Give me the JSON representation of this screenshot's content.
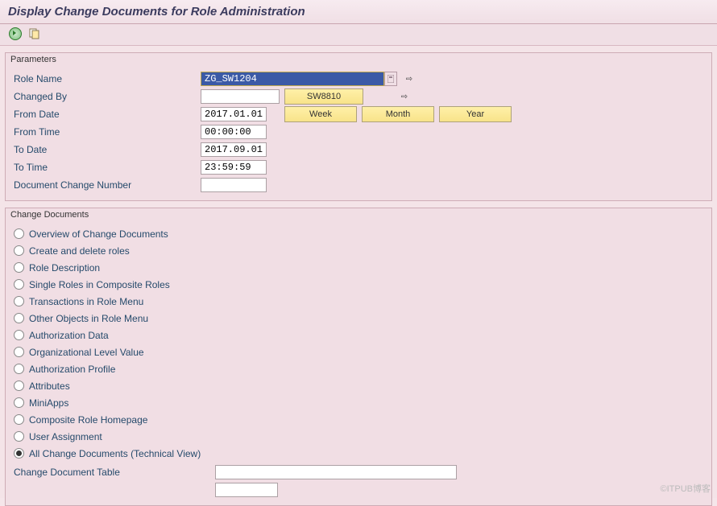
{
  "title": "Display Change Documents for Role Administration",
  "parameters": {
    "legend": "Parameters",
    "roleName": {
      "label": "Role Name",
      "value": "ZG_SW1204"
    },
    "changedBy": {
      "label": "Changed By",
      "value": "",
      "me": "SW8810"
    },
    "fromDate": {
      "label": "From Date",
      "value": "2017.01.01"
    },
    "fromTime": {
      "label": "From Time",
      "value": "00:00:00"
    },
    "toDate": {
      "label": "To Date",
      "value": "2017.09.01"
    },
    "toTime": {
      "label": "To Time",
      "value": "23:59:59"
    },
    "docChangeNum": {
      "label": "Document Change Number",
      "value": ""
    },
    "buttons": {
      "week": "Week",
      "month": "Month",
      "year": "Year"
    }
  },
  "changeDocs": {
    "legend": "Change Documents",
    "options": [
      "Overview of Change Documents",
      "Create and delete roles",
      "Role Description",
      "Single Roles in Composite Roles",
      "Transactions in Role Menu",
      "Other Objects in Role Menu",
      "Authorization Data",
      "Organizational Level Value",
      "Authorization Profile",
      "Attributes",
      "MiniApps",
      "Composite Role Homepage",
      "User Assignment",
      "All Change Documents (Technical View)"
    ],
    "selectedIndex": 13,
    "tableLabel": "Change Document Table",
    "tableValue": ""
  },
  "watermark": "©ITPUB博客"
}
